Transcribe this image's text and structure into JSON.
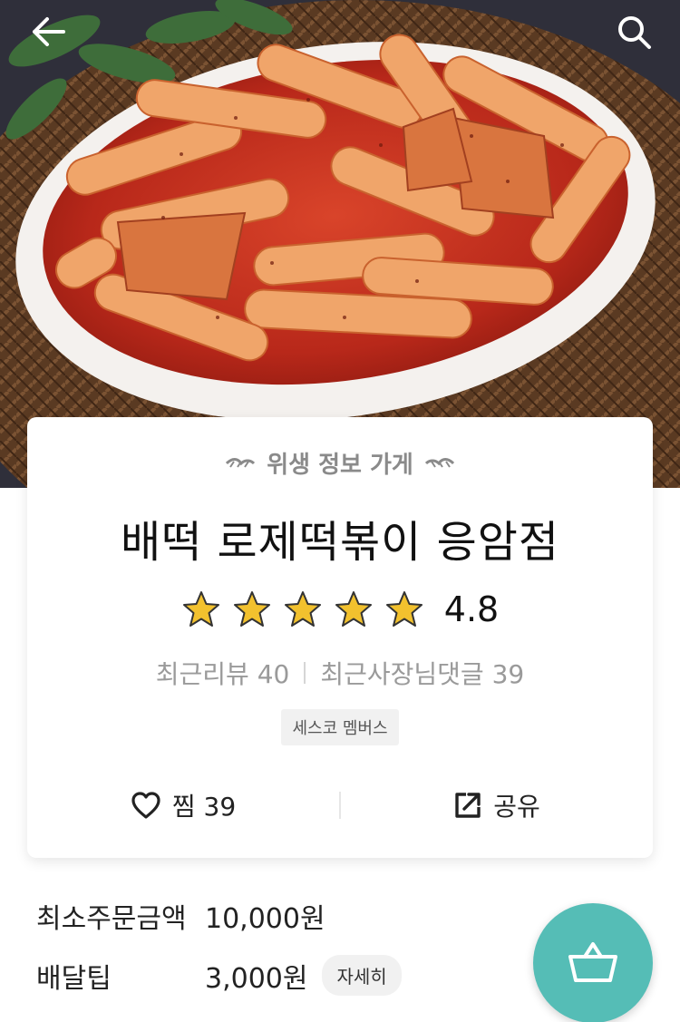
{
  "nav": {
    "back_icon": "arrow-left-icon",
    "search_icon": "search-icon"
  },
  "store": {
    "badge": "위생 정보 가게",
    "name": "배떡 로제떡볶이 응암점",
    "rating": 4.8,
    "rating_text": "4.8",
    "stars": 5,
    "recent_reviews": "최근리뷰 40",
    "owner_replies": "최근사장님댓글 39",
    "tag": "세스코 멤버스"
  },
  "actions": {
    "like_icon": "heart-outline-icon",
    "like_label": "찜 39",
    "share_icon": "share-icon",
    "share_label": "공유"
  },
  "delivery": {
    "min_order_label": "최소주문금액",
    "min_order_value": "10,000원",
    "fee_label": "배달팁",
    "fee_value": "3,000원",
    "detail_button": "자세히"
  },
  "cart": {
    "icon": "shopping-basket-icon"
  },
  "colors": {
    "accent": "#55bdb6",
    "star": "#f2c12e",
    "sauce": "#c7301d"
  }
}
